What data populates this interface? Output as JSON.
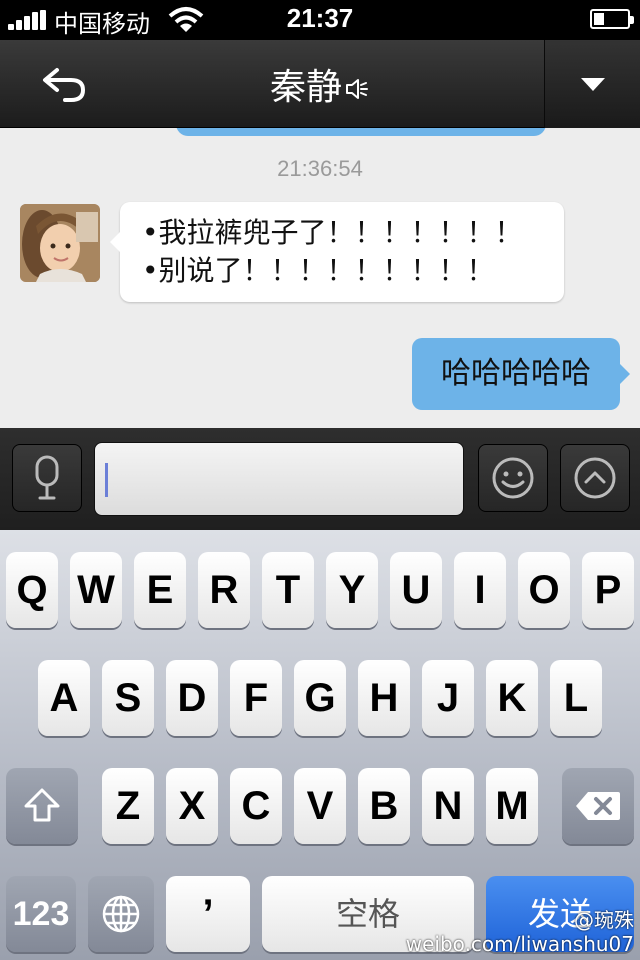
{
  "status_bar": {
    "carrier": "中国移动",
    "time": "21:37"
  },
  "nav": {
    "title": "秦静"
  },
  "chat": {
    "timestamp": "21:36:54",
    "incoming_lines": [
      "•我拉裤兜子了！！！！！！！",
      "•别说了！！！！！！！！！"
    ],
    "outgoing": "哈哈哈哈哈"
  },
  "keyboard": {
    "row1": [
      "Q",
      "W",
      "E",
      "R",
      "T",
      "Y",
      "U",
      "I",
      "O",
      "P"
    ],
    "row2": [
      "A",
      "S",
      "D",
      "F",
      "G",
      "H",
      "J",
      "K",
      "L"
    ],
    "row3": [
      "Z",
      "X",
      "C",
      "V",
      "B",
      "N",
      "M"
    ],
    "numbers_key": "123",
    "apostrophe_key": "’",
    "space_key": "空格",
    "send_key": "发送"
  },
  "watermark": {
    "user": "@琬殊",
    "url": "weibo.com/liwanshu07"
  },
  "colors": {
    "outgoing_bubble": "#6db3e8",
    "send_key": "#2f74e0",
    "caret": "#6b7fd7"
  }
}
